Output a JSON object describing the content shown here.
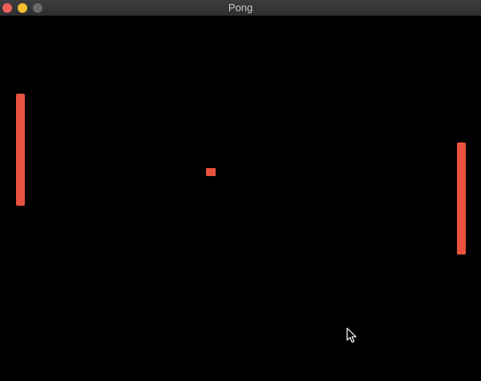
{
  "window": {
    "title": "Pong"
  },
  "titlebar": {
    "buttons": [
      {
        "name": "close",
        "color": "#ed5f56"
      },
      {
        "name": "minimize",
        "color": "#f5bf2f"
      },
      {
        "name": "zoom",
        "color": "#6b6b6d"
      }
    ]
  },
  "game": {
    "background_color": "#000000",
    "object_color": "#e8523f",
    "objects": [
      "left-paddle",
      "right-paddle",
      "ball"
    ]
  },
  "icons": {
    "cursor": "mouse-pointer-icon"
  }
}
